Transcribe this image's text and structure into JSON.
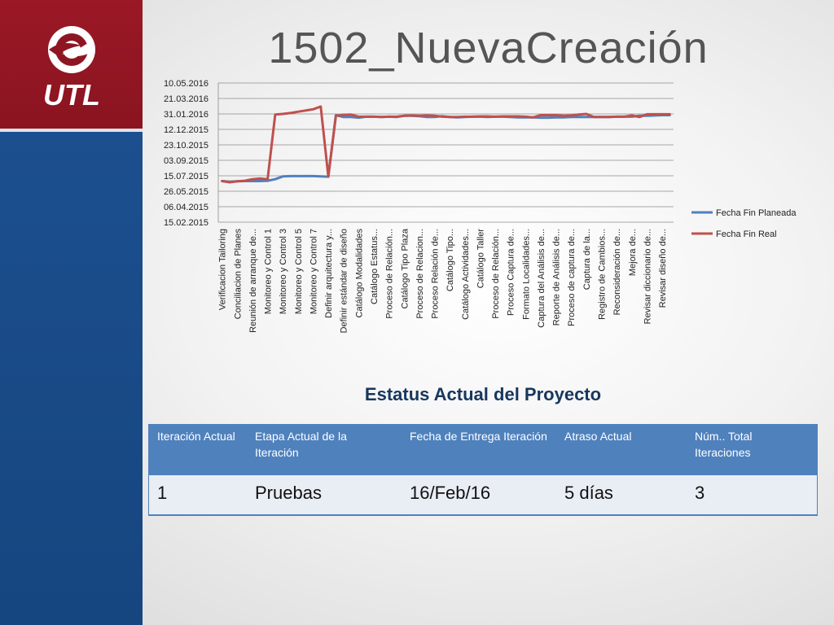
{
  "slide": {
    "title": "1502_NuevaCreación"
  },
  "logo": {
    "text": "UTL"
  },
  "colors": {
    "planned": "#4f81bd",
    "real": "#c0504d",
    "sidebar_top": "#9b1826",
    "sidebar_bottom": "#1c4f8f"
  },
  "chart_data": {
    "type": "line",
    "title": "",
    "xlabel": "",
    "ylabel": "",
    "y_tick_labels": [
      "15.02.2015",
      "06.04.2015",
      "26.05.2015",
      "15.07.2015",
      "03.09.2015",
      "23.10.2015",
      "12.12.2015",
      "31.01.2016",
      "21.03.2016",
      "10.05.2016"
    ],
    "ylim": [
      "2015-02-15",
      "2016-05-10"
    ],
    "grid": true,
    "legend": "right",
    "categories": [
      "Verificacion Tailoring",
      "",
      "Conciliacion de Planes",
      "",
      "Reunión de arranque de...",
      "",
      "Monitoreo y Control 1",
      "",
      "Monitoreo y Control 3",
      "",
      "Monitoreo y Control 5",
      "",
      "Monitoreo y Control 7",
      "",
      "Definir arquitectura y...",
      "",
      "Definir estándar de diseño",
      "",
      "Catálogo Modalidades",
      "",
      "Catálogo Estatus...",
      "",
      "Proceso de Relación...",
      "",
      "Catálogo Tipo Plaza",
      "",
      "Proceso de Relacion...",
      "",
      "Proceso Relación de...",
      "",
      "Catálogo Tipo...",
      "",
      "Catálogo Actividades...",
      "",
      "Catálogo Taller",
      "",
      "Proceso de Relación...",
      "",
      "Proceso Captura de...",
      "",
      "Formato Localidades...",
      "",
      "Captura del Análisis de...",
      "",
      "Reporte de Análisis de...",
      "",
      "Proceso de captura de...",
      "",
      "Captura de la...",
      "",
      "Registro de Cambios...",
      "",
      "Reconsideración de...",
      "",
      "Mejora de...",
      "",
      "Revisar diccionario de...",
      "",
      "Revisar diseño de...",
      ""
    ],
    "series": [
      {
        "name": "Fecha Fin Planeada",
        "values": [
          "2015-06-28",
          "2015-06-26",
          "2015-06-27",
          "2015-06-28",
          "2015-06-28",
          "2015-06-28",
          "2015-06-29",
          "2015-07-04",
          "2015-07-13",
          "2015-07-14",
          "2015-07-14",
          "2015-07-14",
          "2015-07-14",
          "2015-07-13",
          "2015-07-12",
          "2016-01-27",
          "2016-01-21",
          "2016-01-21",
          "2016-01-19",
          "2016-01-22",
          "2016-01-22",
          "2016-01-21",
          "2016-01-22",
          "2016-01-21",
          "2016-01-25",
          "2016-01-25",
          "2016-01-24",
          "2016-01-21",
          "2016-01-21",
          "2016-01-24",
          "2016-01-21",
          "2016-01-20",
          "2016-01-21",
          "2016-01-22",
          "2016-01-22",
          "2016-01-21",
          "2016-01-22",
          "2016-01-22",
          "2016-01-21",
          "2016-01-20",
          "2016-01-20",
          "2016-01-20",
          "2016-01-19",
          "2016-01-19",
          "2016-01-20",
          "2016-01-20",
          "2016-01-21",
          "2016-01-21",
          "2016-01-21",
          "2016-01-21",
          "2016-01-21",
          "2016-01-21",
          "2016-01-22",
          "2016-01-22",
          "2016-01-22",
          "2016-01-25",
          "2016-01-25",
          "2016-01-26",
          "2016-01-27",
          "2016-01-27"
        ]
      },
      {
        "name": "Fecha Fin Real",
        "values": [
          "2015-06-28",
          "2015-06-24",
          "2015-06-27",
          "2015-06-29",
          "2015-07-04",
          "2015-07-06",
          "2015-07-04",
          "2016-01-29",
          "2016-01-31",
          "2016-02-03",
          "2016-02-07",
          "2016-02-11",
          "2016-02-15",
          "2016-02-24",
          "2015-07-12",
          "2016-01-25",
          "2016-01-28",
          "2016-01-29",
          "2016-01-22",
          "2016-01-22",
          "2016-01-22",
          "2016-01-21",
          "2016-01-22",
          "2016-01-22",
          "2016-01-25",
          "2016-01-26",
          "2016-01-25",
          "2016-01-26",
          "2016-01-25",
          "2016-01-22",
          "2016-01-21",
          "2016-01-21",
          "2016-01-22",
          "2016-01-22",
          "2016-01-23",
          "2016-01-23",
          "2016-01-22",
          "2016-01-23",
          "2016-01-23",
          "2016-01-23",
          "2016-01-22",
          "2016-01-20",
          "2016-01-27",
          "2016-01-27",
          "2016-01-27",
          "2016-01-25",
          "2016-01-26",
          "2016-01-29",
          "2016-01-31",
          "2016-01-21",
          "2016-01-21",
          "2016-01-21",
          "2016-01-22",
          "2016-01-22",
          "2016-01-26",
          "2016-01-21",
          "2016-01-30",
          "2016-01-30",
          "2016-01-30",
          "2016-01-30"
        ]
      }
    ]
  },
  "status": {
    "title": "Estatus Actual del Proyecto",
    "headers": [
      "Iteración Actual",
      "Etapa Actual de la Iteración",
      "Fecha de Entrega Iteración",
      "Atraso Actual",
      "Núm.. Total Iteraciones"
    ],
    "values": [
      "1",
      "Pruebas",
      "16/Feb/16",
      "5 días",
      "3"
    ]
  }
}
